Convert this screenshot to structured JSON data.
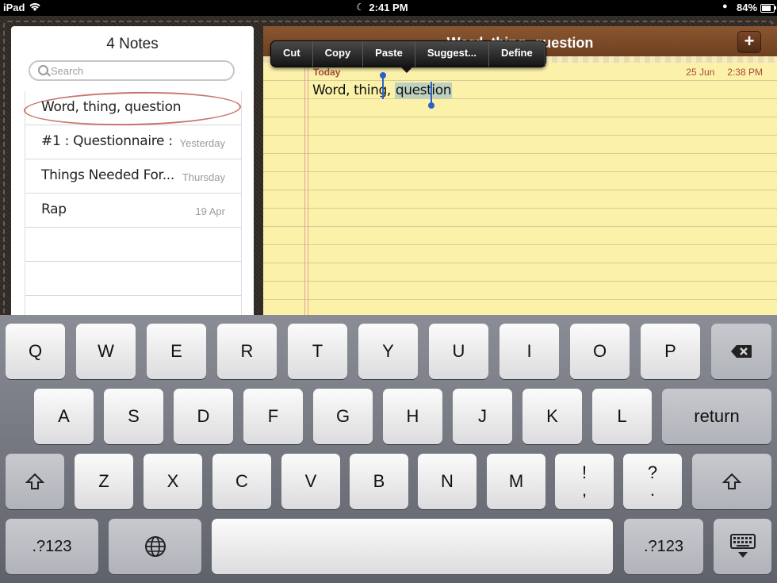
{
  "status_bar": {
    "carrier": "iPad",
    "time": "2:41 PM",
    "battery": "84%"
  },
  "list": {
    "title": "4 Notes",
    "search_placeholder": "Search",
    "notes": [
      {
        "title": "Word, thing, question",
        "date": ""
      },
      {
        "title": "#1 : Questionnaire :",
        "date": "Yesterday"
      },
      {
        "title": "Things Needed For...",
        "date": "Thursday"
      },
      {
        "title": "Rap",
        "date": "19 Apr"
      }
    ]
  },
  "editor": {
    "header_title": "Word, thing, question",
    "add_label": "+",
    "day_label": "Today",
    "date": "25 Jun",
    "time": "2:38 PM",
    "text_before": "Word, thing, ",
    "text_selected": "question"
  },
  "context_menu": {
    "items": [
      "Cut",
      "Copy",
      "Paste",
      "Suggest...",
      "Define"
    ]
  },
  "keyboard": {
    "row1": [
      "Q",
      "W",
      "E",
      "R",
      "T",
      "Y",
      "U",
      "I",
      "O",
      "P"
    ],
    "row2": [
      "A",
      "S",
      "D",
      "F",
      "G",
      "H",
      "J",
      "K",
      "L"
    ],
    "return": "return",
    "row3": [
      "Z",
      "X",
      "C",
      "V",
      "B",
      "N",
      "M"
    ],
    "excl_top": "!",
    "excl_bottom": ",",
    "quest_top": "?",
    "quest_bottom": ".",
    "numbers_label": ".?123"
  }
}
